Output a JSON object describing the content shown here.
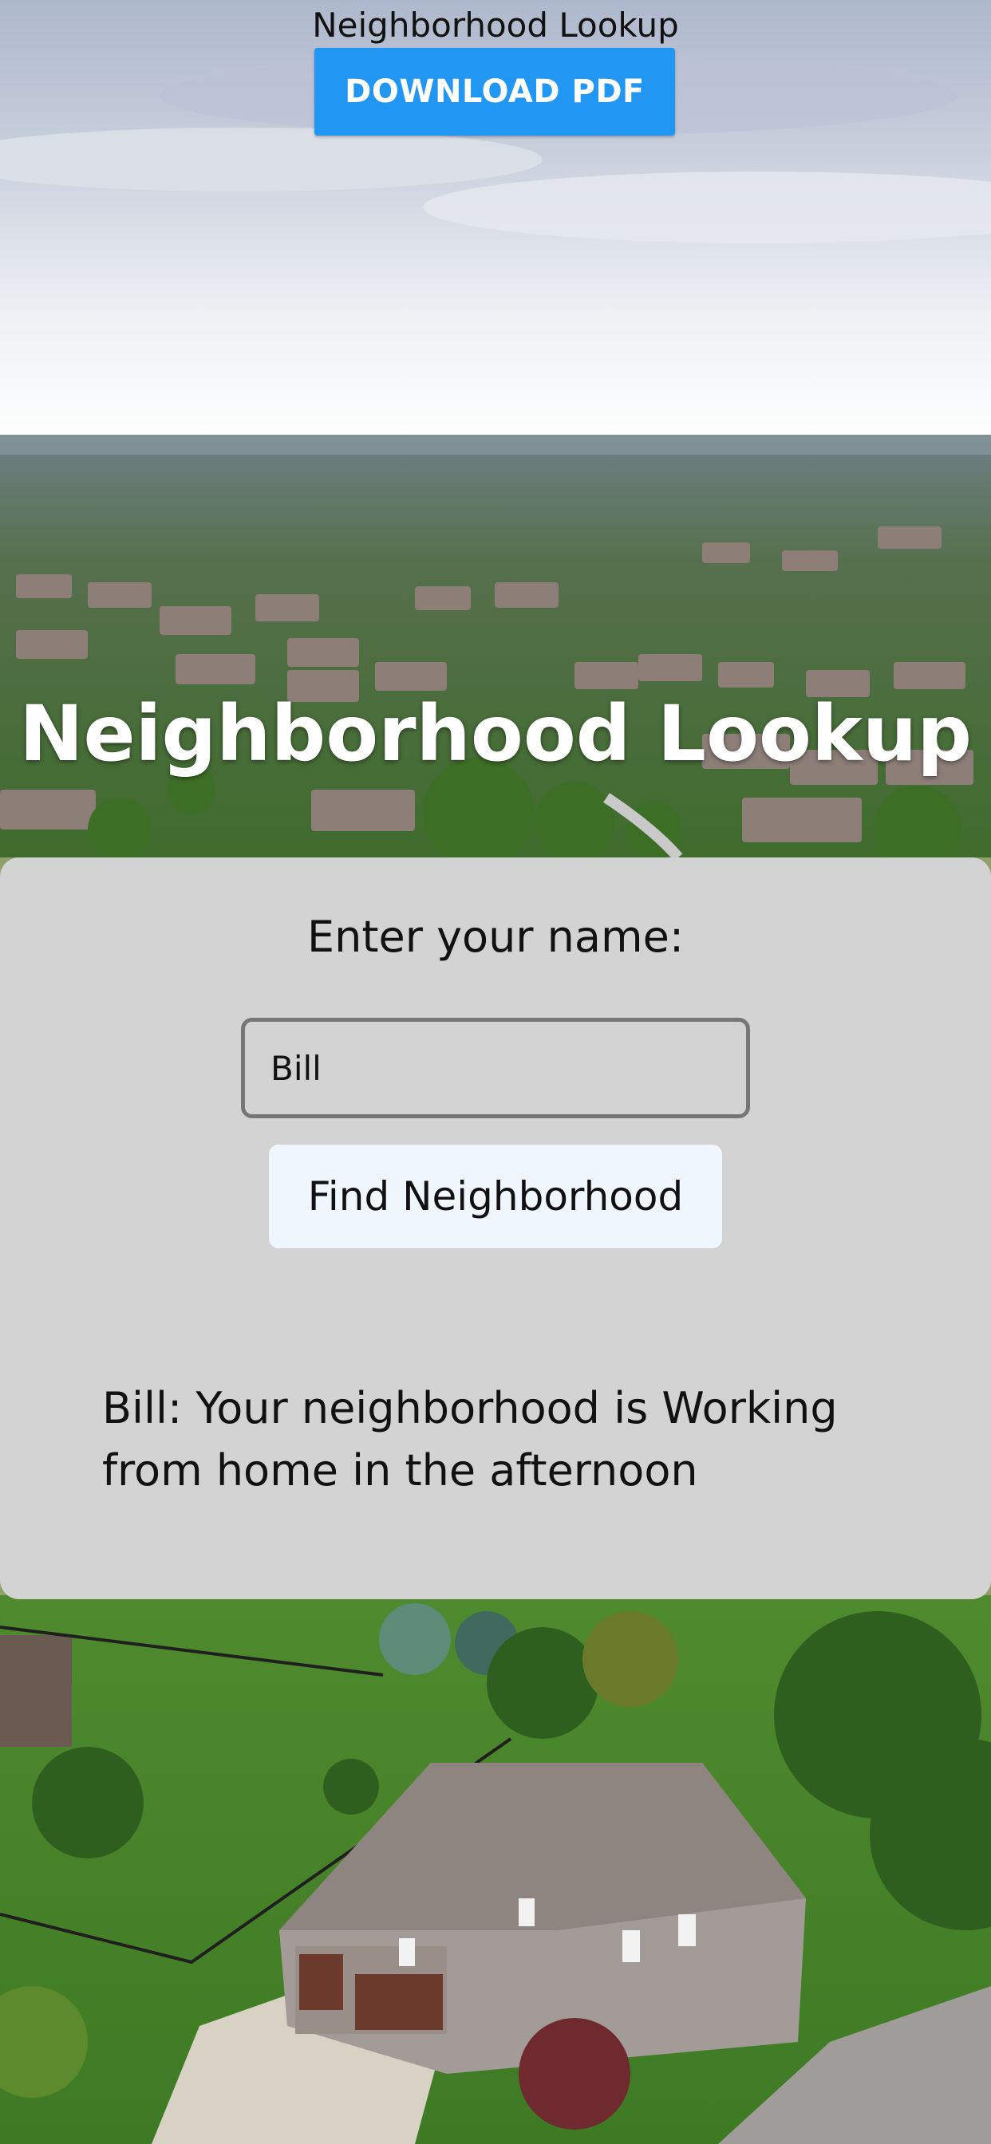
{
  "header": {
    "title": "Neighborhood Lookup",
    "download_label": "DOWNLOAD PDF"
  },
  "hero": {
    "title": "Neighborhood Lookup"
  },
  "form": {
    "label": "Enter your name:",
    "name_value": "Bill",
    "find_label": "Find Neighborhood",
    "result": "Bill: Your neighborhood is Working from home in the afternoon"
  },
  "colors": {
    "download_button": "#2196f3",
    "card_background": "#d3d3d3",
    "find_button": "#f0f6fd"
  }
}
